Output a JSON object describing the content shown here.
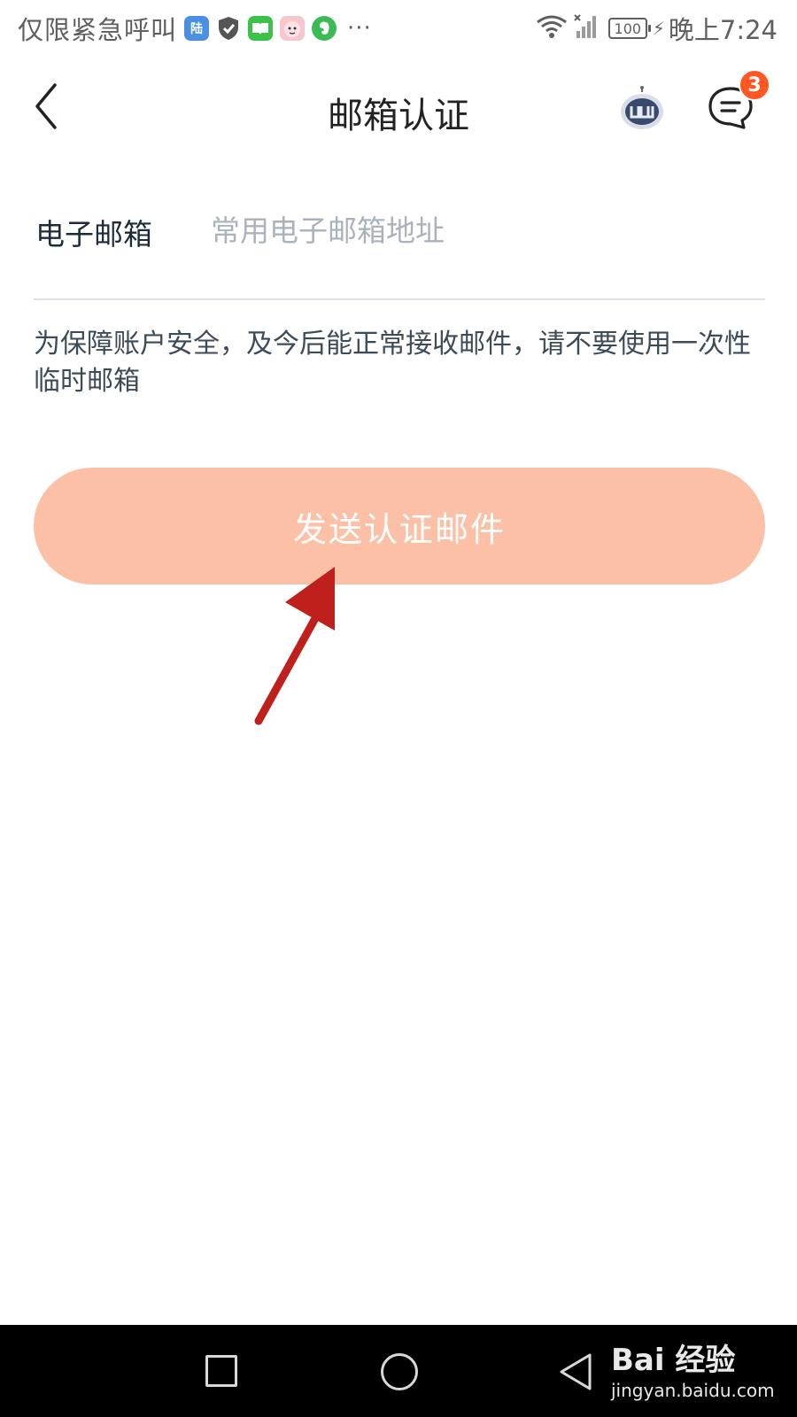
{
  "status_bar": {
    "carrier": "仅限紧急呼叫",
    "app_badge_text": "陆",
    "more": "···",
    "battery": "100",
    "time": "晚上7:24"
  },
  "header": {
    "title": "邮箱认证",
    "message_badge": "3"
  },
  "form": {
    "email_label": "电子邮箱",
    "email_value": "",
    "email_placeholder": "常用电子邮箱地址",
    "notice": "为保障账户安全，及今后能正常接收邮件，请不要使用一次性临时邮箱",
    "send_button": "发送认证邮件",
    "send_button_color": "#fcc0a6"
  },
  "watermark": {
    "main": "Bai 经验",
    "sub": "jingyan.baidu.com"
  },
  "icons": [
    "back-arrow-icon",
    "robot-icon",
    "message-icon",
    "annotation-arrow",
    "nav-recent-icon",
    "nav-home-icon",
    "nav-back-icon"
  ]
}
